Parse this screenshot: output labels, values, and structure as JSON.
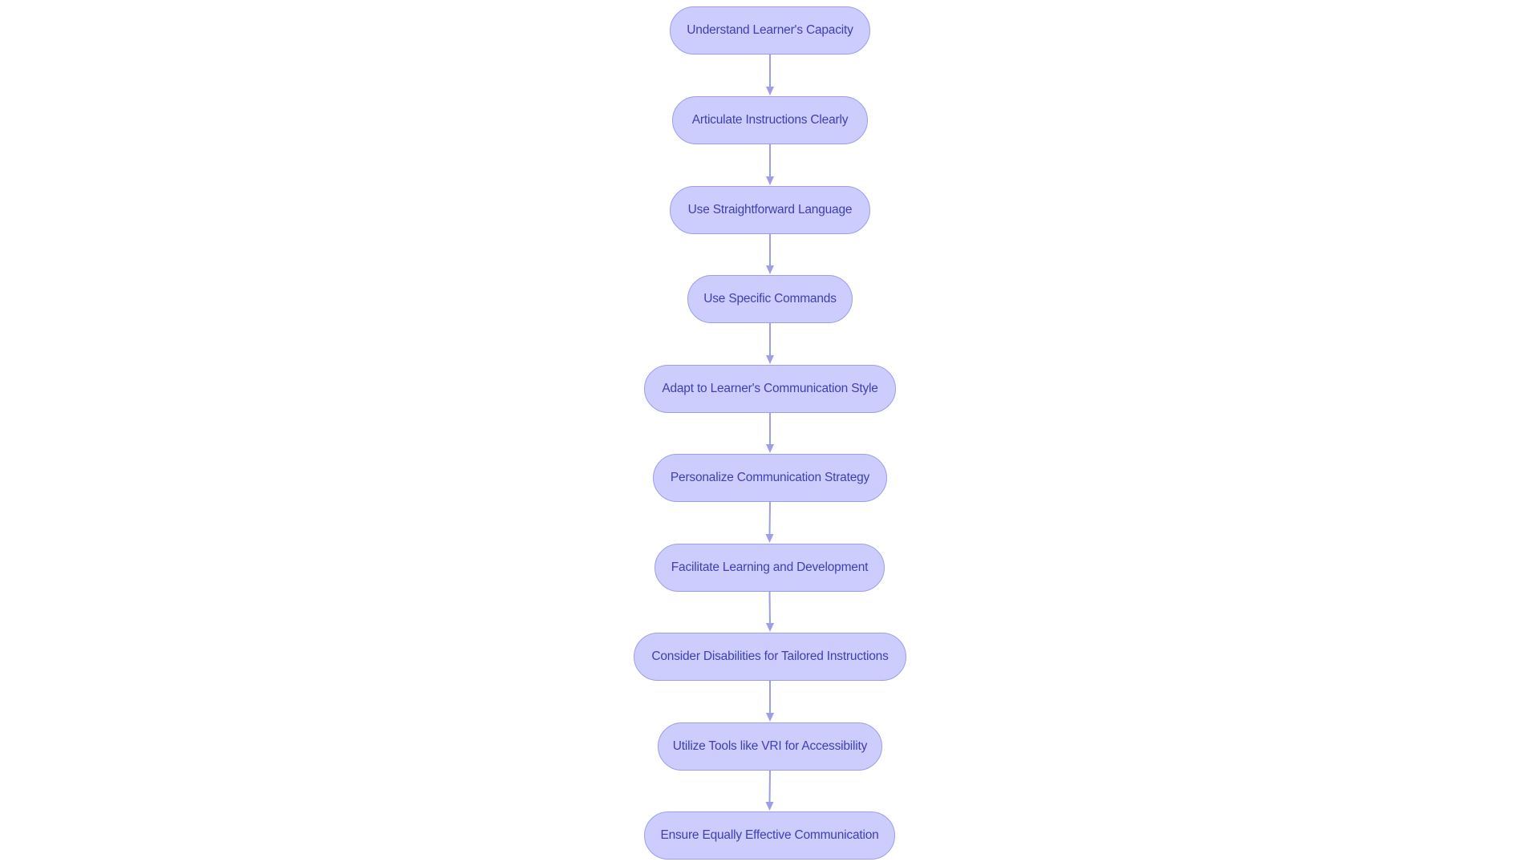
{
  "diagram": {
    "type": "flowchart",
    "direction": "top-to-bottom",
    "colors": {
      "node_fill": "#cdcdfd",
      "node_border": "#9d9deb",
      "node_text": "#3f3fb0",
      "edge": "#9d9deb",
      "background": "#ffffff"
    },
    "nodes": [
      {
        "id": "n1",
        "label": "Understand Learner's Capacity"
      },
      {
        "id": "n2",
        "label": "Articulate Instructions Clearly"
      },
      {
        "id": "n3",
        "label": "Use Straightforward Language"
      },
      {
        "id": "n4",
        "label": "Use Specific Commands"
      },
      {
        "id": "n5",
        "label": "Adapt to Learner's Communication Style"
      },
      {
        "id": "n6",
        "label": "Personalize Communication Strategy"
      },
      {
        "id": "n7",
        "label": "Facilitate Learning and Development"
      },
      {
        "id": "n8",
        "label": "Consider Disabilities for Tailored Instructions"
      },
      {
        "id": "n9",
        "label": "Utilize Tools like VRI for Accessibility"
      },
      {
        "id": "n10",
        "label": "Ensure Equally Effective Communication"
      }
    ],
    "edges": [
      {
        "from": "n1",
        "to": "n2"
      },
      {
        "from": "n2",
        "to": "n3"
      },
      {
        "from": "n3",
        "to": "n4"
      },
      {
        "from": "n4",
        "to": "n5"
      },
      {
        "from": "n5",
        "to": "n6"
      },
      {
        "from": "n6",
        "to": "n7"
      },
      {
        "from": "n7",
        "to": "n8"
      },
      {
        "from": "n8",
        "to": "n9"
      },
      {
        "from": "n9",
        "to": "n10"
      }
    ]
  }
}
